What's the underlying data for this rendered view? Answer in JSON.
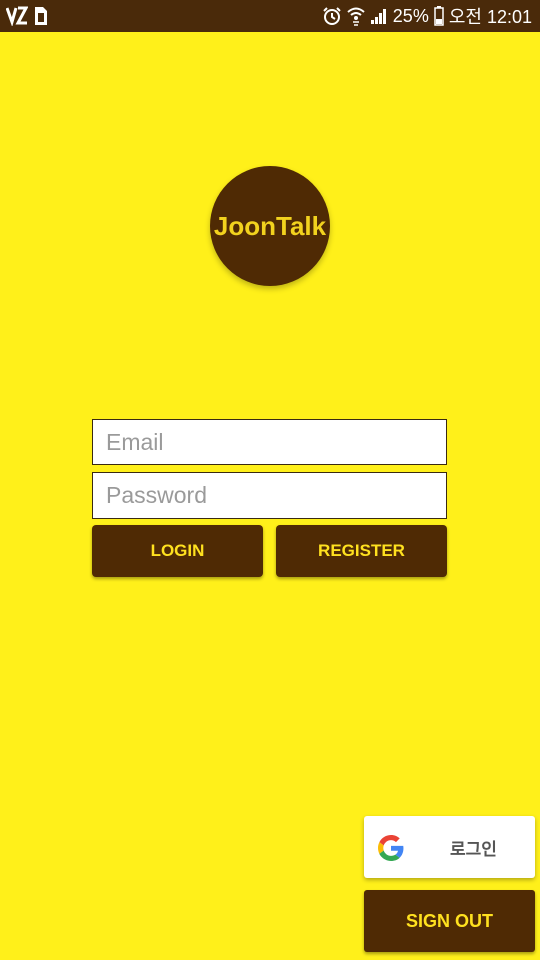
{
  "status_bar": {
    "battery_percent": "25%",
    "time": "오전 12:01",
    "left_icons": [
      "vpn-key-icon",
      "sim-card-icon"
    ],
    "right_icons": [
      "alarm-icon",
      "wifi-icon",
      "signal-icon",
      "battery-icon"
    ]
  },
  "logo": {
    "text": "JoonTalk"
  },
  "login_form": {
    "email_placeholder": "Email",
    "password_placeholder": "Password",
    "login_label": "LOGIN",
    "register_label": "REGISTER"
  },
  "google_sign_in": {
    "label": "로그인",
    "icon": "google-g-icon"
  },
  "sign_out": {
    "label": "SIGN OUT"
  },
  "colors": {
    "background": "#FFF01A",
    "status_bar": "#4A2A0A",
    "brand_brown": "#4F2A04",
    "button_text": "#FFE11F"
  }
}
